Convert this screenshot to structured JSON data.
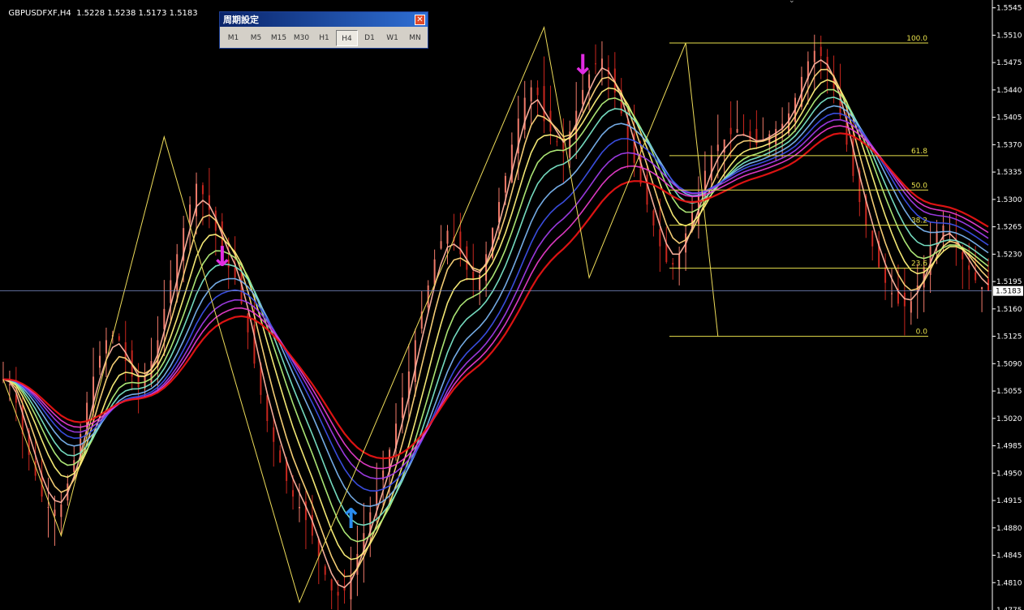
{
  "header": {
    "symbol": "GBPUSDFXF,H4",
    "ohlc": "1.5228 1.5238 1.5173 1.5183"
  },
  "period_panel": {
    "title": "周期設定",
    "close_label": "✕",
    "buttons": [
      "M1",
      "M5",
      "M15",
      "M30",
      "H1",
      "H4",
      "D1",
      "W1",
      "MN"
    ],
    "active": "H4"
  },
  "colors": {
    "background": "#000000",
    "candle_up": "#f07a6a",
    "candle_down": "#c8261e",
    "zigzag": "#eedc5a",
    "fib_line": "#e8e04c",
    "sell_arrow": "#e22ce2",
    "buy_arrow": "#2a8cf0",
    "current_price_line": "#7a8cc8"
  },
  "chart_data": {
    "type": "line",
    "title": "GBPUSDFXF,H4",
    "y_axis": {
      "ticks": [
        "1.5545",
        "1.5510",
        "1.5475",
        "1.5440",
        "1.5405",
        "1.5370",
        "1.5335",
        "1.5300",
        "1.5265",
        "1.5230",
        "1.5195",
        "1.5160",
        "1.5125",
        "1.5090",
        "1.5055",
        "1.5020",
        "1.4985",
        "1.4950",
        "1.4915",
        "1.4880",
        "1.4845",
        "1.4810"
      ],
      "ylim": [
        1.4775,
        1.5555
      ],
      "current_price": "1.5183",
      "bottom_partial_tick": "1.4775"
    },
    "bars": 154,
    "moving_average_ribbon": {
      "count": 10,
      "colors": [
        "#ffb4a0",
        "#ffd67a",
        "#fff27a",
        "#b4f07a",
        "#7ae6c8",
        "#7ab4f0",
        "#3c50e8",
        "#a03ce8",
        "#e83ccb",
        "#e81414"
      ]
    },
    "zigzag_points": [
      {
        "bar": 0,
        "price": 1.507
      },
      {
        "bar": 9,
        "price": 1.487
      },
      {
        "bar": 25,
        "price": 1.538
      },
      {
        "bar": 46,
        "price": 1.4785
      },
      {
        "bar": 84,
        "price": 1.552
      },
      {
        "bar": 91,
        "price": 1.52
      },
      {
        "bar": 106,
        "price": 1.55
      },
      {
        "bar": 111,
        "price": 1.5125
      }
    ],
    "fibonacci": {
      "levels": [
        {
          "label": "100.0",
          "price": 1.55
        },
        {
          "label": "61.8",
          "price": 1.5356
        },
        {
          "label": "50.0",
          "price": 1.5312
        },
        {
          "label": "38.2",
          "price": 1.5267
        },
        {
          "label": "23.6",
          "price": 1.5212
        },
        {
          "label": "0.0",
          "price": 1.5125
        }
      ]
    },
    "signals": [
      {
        "type": "sell",
        "bar": 34,
        "price": 1.5215,
        "glyph": "↓"
      },
      {
        "type": "buy",
        "bar": 54,
        "price": 1.488,
        "glyph": "↑"
      },
      {
        "type": "sell",
        "bar": 90,
        "price": 1.546,
        "glyph": "↓"
      }
    ],
    "close_path": [
      1.507,
      1.506,
      1.5,
      1.496,
      1.492,
      1.49,
      1.491,
      1.495,
      1.5,
      1.506,
      1.51,
      1.513,
      1.512,
      1.508,
      1.506,
      1.508,
      1.512,
      1.518,
      1.523,
      1.528,
      1.532,
      1.53,
      1.526,
      1.522,
      1.52,
      1.515,
      1.509,
      1.503,
      1.499,
      1.495,
      1.492,
      1.49,
      1.487,
      1.483,
      1.48,
      1.479,
      1.482,
      1.486,
      1.49,
      1.494,
      1.498,
      1.503,
      1.508,
      1.514,
      1.519,
      1.524,
      1.526,
      1.524,
      1.521,
      1.519,
      1.523,
      1.528,
      1.533,
      1.539,
      1.543,
      1.545,
      1.54,
      1.538,
      1.536,
      1.54,
      1.544,
      1.547,
      1.548,
      1.545,
      1.541,
      1.536,
      1.532,
      1.528,
      1.524,
      1.521,
      1.523,
      1.527,
      1.531,
      1.535,
      1.537,
      1.538,
      1.539,
      1.538,
      1.537,
      1.538,
      1.539,
      1.54,
      1.543,
      1.547,
      1.549,
      1.548,
      1.544,
      1.539,
      1.533,
      1.528,
      1.524,
      1.52,
      1.518,
      1.516,
      1.517,
      1.52,
      1.524,
      1.527,
      1.526,
      1.523,
      1.521,
      1.519,
      1.5183
    ]
  }
}
